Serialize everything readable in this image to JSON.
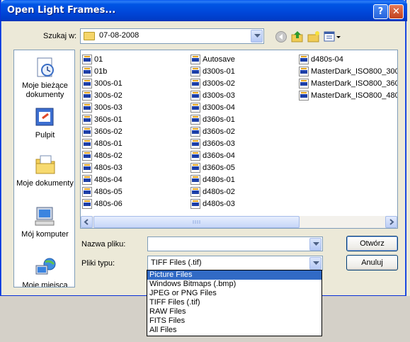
{
  "window": {
    "title": "Open Light Frames..."
  },
  "titlebar": {
    "help_icon": "?",
    "close_icon": "✕"
  },
  "lookin": {
    "label": "Szukaj w:",
    "value": "07-08-2008"
  },
  "toolbar": {
    "icons": [
      "back-icon",
      "up-folder-icon",
      "new-folder-icon",
      "view-menu-icon"
    ]
  },
  "places": [
    {
      "label": "Moje bieżące dokumenty",
      "icon": "recent-documents-icon"
    },
    {
      "label": "Pulpit",
      "icon": "desktop-icon"
    },
    {
      "label": "Moje dokumenty",
      "icon": "my-documents-icon"
    },
    {
      "label": "Mój komputer",
      "icon": "my-computer-icon"
    },
    {
      "label": "Moje miejsca",
      "icon": "network-places-icon"
    }
  ],
  "files": {
    "col1": [
      "01",
      "01b",
      "300s-01",
      "300s-02",
      "300s-03",
      "360s-01",
      "360s-02",
      "480s-01",
      "480s-02",
      "480s-03",
      "480s-04",
      "480s-05",
      "480s-06"
    ],
    "col2": [
      "Autosave",
      "d300s-01",
      "d300s-02",
      "d300s-03",
      "d300s-04",
      "d360s-01",
      "d360s-02",
      "d360s-03",
      "d360s-04",
      "d360s-05",
      "d480s-01",
      "d480s-02",
      "d480s-03"
    ],
    "col3": [
      "d480s-04",
      "MasterDark_ISO800_300",
      "MasterDark_ISO800_360",
      "MasterDark_ISO800_480"
    ]
  },
  "filename": {
    "label": "Nazwa pliku:",
    "value": ""
  },
  "filetype": {
    "label": "Pliki typu:",
    "value": "TIFF Files (.tif)",
    "options": [
      "Picture Files",
      "Windows Bitmaps (.bmp)",
      "JPEG or PNG Files",
      "TIFF Files (.tif)",
      "RAW Files",
      "FITS Files",
      "All Files"
    ],
    "highlighted": "Picture Files"
  },
  "buttons": {
    "open": "Otwórz",
    "cancel": "Anuluj"
  },
  "colors": {
    "titlebar": "#0054e3",
    "highlight": "#316ac5",
    "dialog_bg": "#ece9d8"
  }
}
